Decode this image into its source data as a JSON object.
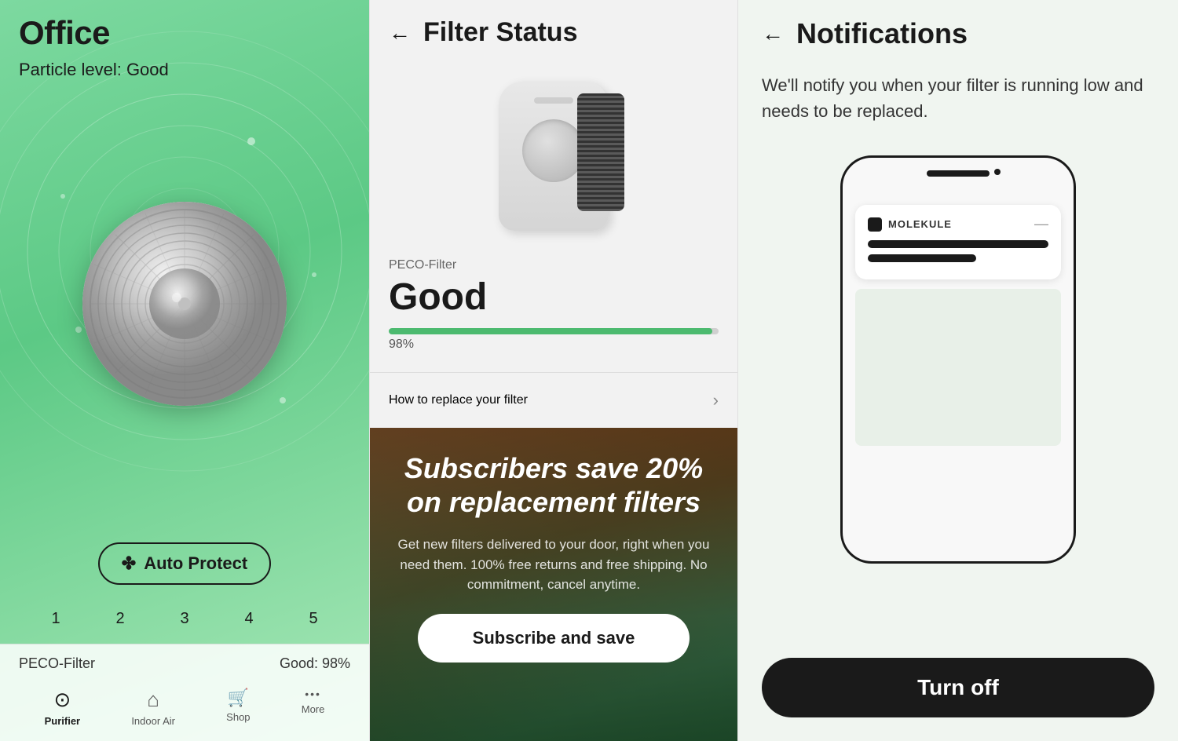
{
  "panel_office": {
    "title": "Office",
    "particle_level": "Particle level: Good",
    "auto_protect_label": "Auto Protect",
    "speed_numbers": [
      "1",
      "2",
      "3",
      "4",
      "5"
    ],
    "filter_label": "PECO-Filter",
    "filter_status": "Good: 98%",
    "nav": {
      "items": [
        {
          "label": "Purifier",
          "icon": "⊙",
          "active": true
        },
        {
          "label": "Indoor Air",
          "icon": "⌂",
          "active": false
        },
        {
          "label": "Shop",
          "icon": "🛒",
          "active": false
        },
        {
          "label": "More",
          "icon": "•••",
          "active": false
        }
      ]
    }
  },
  "panel_filter": {
    "back_label": "←",
    "title": "Filter Status",
    "filter_type": "PECO-Filter",
    "condition": "Good",
    "progress_percent": "98",
    "progress_label": "98%",
    "replace_text": "How to replace your filter",
    "promo": {
      "headline": "Subscribers save 20% on replacement filters",
      "subtext": "Get new filters delivered to your door, right when you need them. 100% free returns and free shipping. No commitment, cancel anytime.",
      "cta_label": "Subscribe and save"
    }
  },
  "panel_notifications": {
    "back_label": "←",
    "title": "Notifications",
    "description": "We'll notify you when your filter is running low and needs to be replaced.",
    "notification_card": {
      "app_name": "MOLEKULE",
      "dismiss": "—"
    },
    "turn_off_label": "Turn off"
  }
}
